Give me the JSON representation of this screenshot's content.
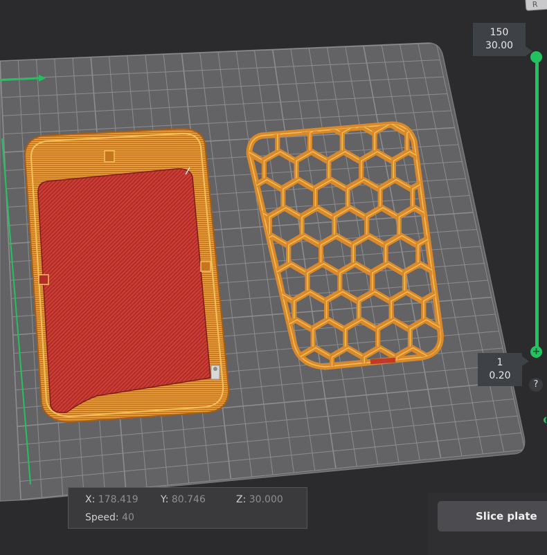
{
  "colors": {
    "background": "#2b2b2d",
    "plate": "#646466",
    "grid": "#8a8a8c",
    "filament": "#d9892c",
    "top_surface": "#b8302a",
    "accent": "#22c35e"
  },
  "corner_tab": {
    "label": "R"
  },
  "layer_slider": {
    "top": {
      "layer": "150",
      "height": "30.00"
    },
    "bottom": {
      "layer": "1",
      "height": "0.20"
    }
  },
  "help": {
    "label": "?"
  },
  "info_panel": {
    "x_label": "X:",
    "x_value": "178.419",
    "y_label": "Y:",
    "y_value": "80.746",
    "z_label": "Z:",
    "z_value": "30.000",
    "speed_label": "Speed:",
    "speed_value": "40"
  },
  "slice_button": {
    "label": "Slice plate"
  },
  "objects": [
    {
      "name": "enclosure-box",
      "icon": "box-shell"
    },
    {
      "name": "honeycomb-lid",
      "icon": "hexagon-grid"
    }
  ]
}
